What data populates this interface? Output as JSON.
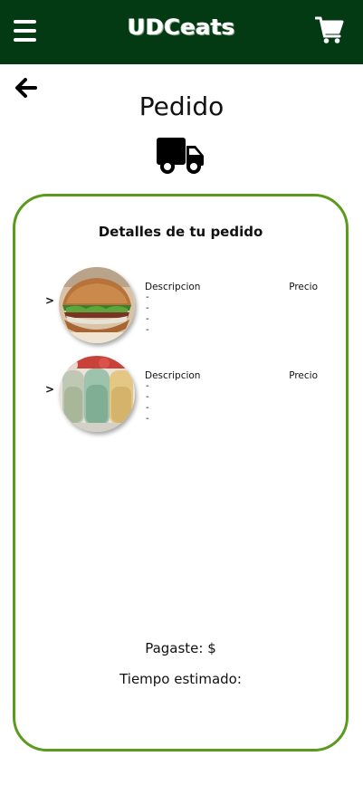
{
  "header": {
    "brand": "UDCeats",
    "bg_color": "#033a14"
  },
  "page": {
    "title": "Pedido"
  },
  "order": {
    "title": "Detalles de tu pedido",
    "items": [
      {
        "chevron": ">",
        "desc_header": "Descripcion",
        "price_header": "Precio",
        "lines": [
          "-",
          "-",
          "-",
          "-"
        ]
      },
      {
        "chevron": ">",
        "desc_header": "Descripcion",
        "price_header": "Precio",
        "lines": [
          "-",
          "-",
          "-",
          "-"
        ]
      }
    ],
    "paid_label": "Pagaste: $",
    "eta_label": "Tiempo estimado:"
  },
  "colors": {
    "card_border": "#5a9a1c"
  }
}
